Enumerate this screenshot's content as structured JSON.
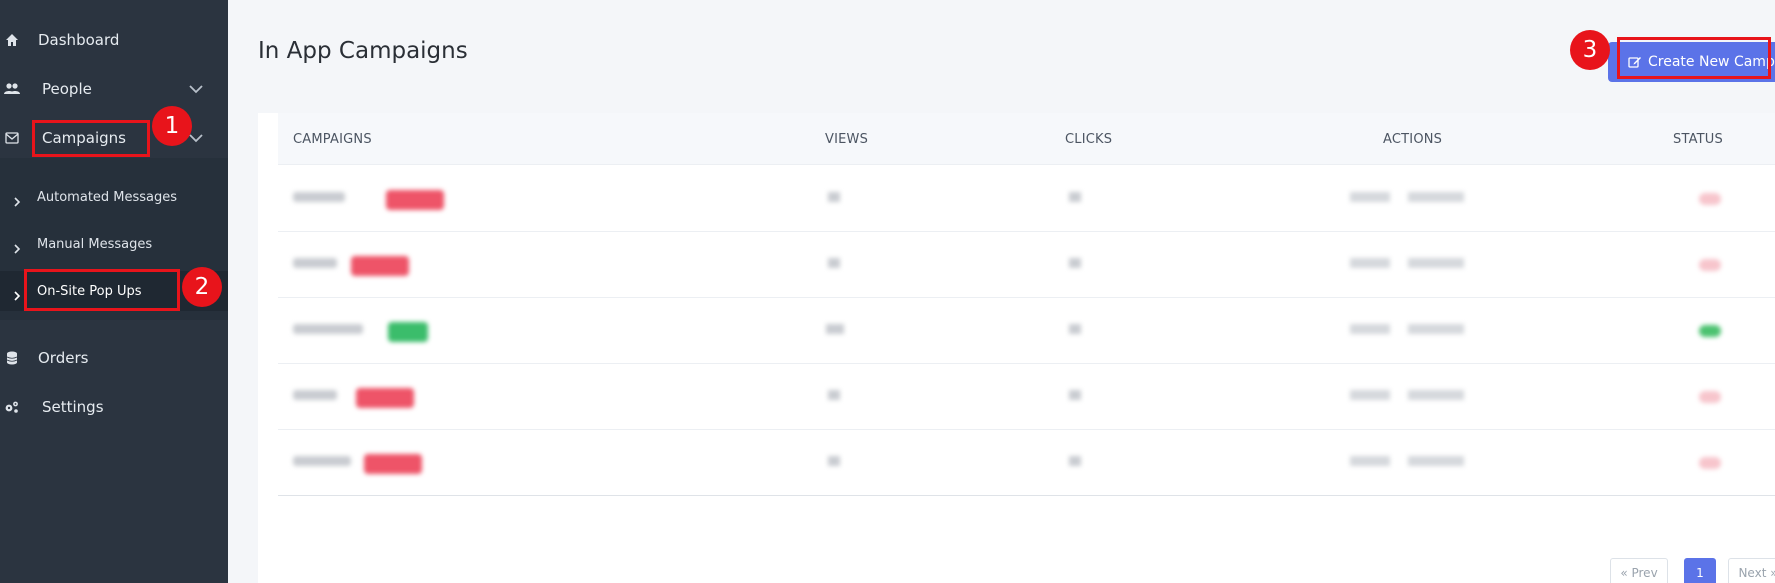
{
  "sidebar": {
    "items": [
      {
        "label": "Dashboard",
        "icon": "home-icon"
      },
      {
        "label": "People",
        "icon": "users-icon"
      },
      {
        "label": "Campaigns",
        "icon": "envelope-icon"
      },
      {
        "label": "Orders",
        "icon": "database-icon"
      },
      {
        "label": "Settings",
        "icon": "gears-icon"
      }
    ],
    "campaigns_submenu": [
      {
        "label": "Automated Messages"
      },
      {
        "label": "Manual Messages"
      },
      {
        "label": "On-Site Pop Ups"
      }
    ]
  },
  "main": {
    "title": "In App Campaigns",
    "create_button_label": "Create New Campa",
    "table": {
      "headers": [
        "CAMPAIGNS",
        "VIEWS",
        "CLICKS",
        "ACTIONS",
        "STATUS"
      ]
    },
    "pagination": {
      "prev_label": "« Prev",
      "current": "1",
      "next_label": "Next »"
    }
  },
  "annotations": {
    "markers": [
      "1",
      "2",
      "3"
    ]
  },
  "colors": {
    "sidebar_bg": "#2b3440",
    "accent": "#5b73e8",
    "annotation": "#e8141b",
    "badge_inactive": "#ee5468",
    "badge_active": "#3bbd6b"
  }
}
